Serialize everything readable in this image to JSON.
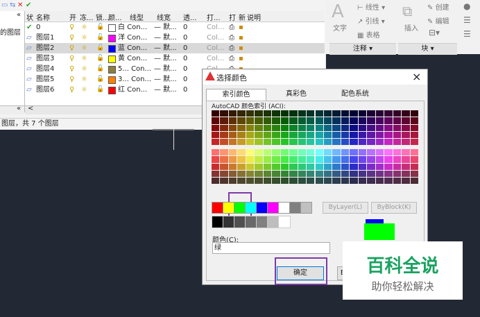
{
  "layer_panel": {
    "tree_label": "的图层",
    "column_headers": [
      "状",
      "名称",
      "开",
      "冻...",
      "锁...",
      "颜...",
      "线型",
      "线宽",
      "透...",
      "打...",
      "打",
      "新",
      "说明"
    ],
    "rows": [
      {
        "name": "0",
        "color_name": "白",
        "color": "#ffffff",
        "linetype": "Con...",
        "lineweight": "— 默...",
        "transparency": "0",
        "plot_style": "Col...",
        "selected": false,
        "status": "current"
      },
      {
        "name": "图层1",
        "color_name": "洋",
        "color": "#ff00ff",
        "linetype": "Con...",
        "lineweight": "— 默...",
        "transparency": "0",
        "plot_style": "Col...",
        "selected": false,
        "status": "layer"
      },
      {
        "name": "图层2",
        "color_name": "蓝",
        "color": "#0000ff",
        "linetype": "Con...",
        "lineweight": "— 默...",
        "transparency": "0",
        "plot_style": "Col...",
        "selected": true,
        "status": "layer"
      },
      {
        "name": "图层3",
        "color_name": "黄",
        "color": "#ffff00",
        "linetype": "Con...",
        "lineweight": "— 默...",
        "transparency": "0",
        "plot_style": "Col...",
        "selected": false,
        "status": "layer"
      },
      {
        "name": "图层4",
        "color_name": "5...",
        "color": "#8c7f3f",
        "linetype": "Con...",
        "lineweight": "— 默...",
        "transparency": "0",
        "plot_style": "Col...",
        "selected": false,
        "status": "layer"
      },
      {
        "name": "图层5",
        "color_name": "3...",
        "color": "#ff7f00",
        "linetype": "Con...",
        "lineweight": "— 默...",
        "transparency": "0",
        "plot_style": "Col...",
        "selected": false,
        "status": "layer"
      },
      {
        "name": "图层6",
        "color_name": "红",
        "color": "#ff0000",
        "linetype": "Con...",
        "lineweight": "— 默...",
        "transparency": "0",
        "plot_style": "Col...",
        "selected": false,
        "status": "layer"
      }
    ],
    "status_text": "图层，共 7 个图层"
  },
  "ribbon": {
    "text_label": "文字",
    "multiline_label": "线性",
    "leader_label": "引线",
    "table_label": "表格",
    "insert_label": "插入",
    "create_label": "创建",
    "edit_label": "编辑",
    "annotation_panel": "注释",
    "block_panel": "块"
  },
  "dialog": {
    "title": "选择颜色",
    "tabs": [
      "索引颜色",
      "真彩色",
      "配色系统"
    ],
    "aci_label": "AutoCAD 颜色索引 (ACI):",
    "bylayer_label": "ByLayer(L)",
    "byblock_label": "ByBlock(K)",
    "color_field_label": "颜色(C):",
    "color_value": "绿",
    "ok_label": "确定",
    "next_button_fragment": "E",
    "close_glyph": "×",
    "standard_colors": [
      "#ff0000",
      "#ffff00",
      "#00ff00",
      "#00ffff",
      "#0000ff",
      "#ff00ff",
      "#ffffff",
      "#808080",
      "#c0c0c0"
    ],
    "gray_colors": [
      "#000000",
      "#333333",
      "#505050",
      "#696969",
      "#808080",
      "#bebebe",
      "#ffffff"
    ],
    "new_color": "#00ff00",
    "old_color": "#0000ff"
  },
  "watermark": {
    "title": "百科全说",
    "subtitle": "助你轻松解决"
  }
}
